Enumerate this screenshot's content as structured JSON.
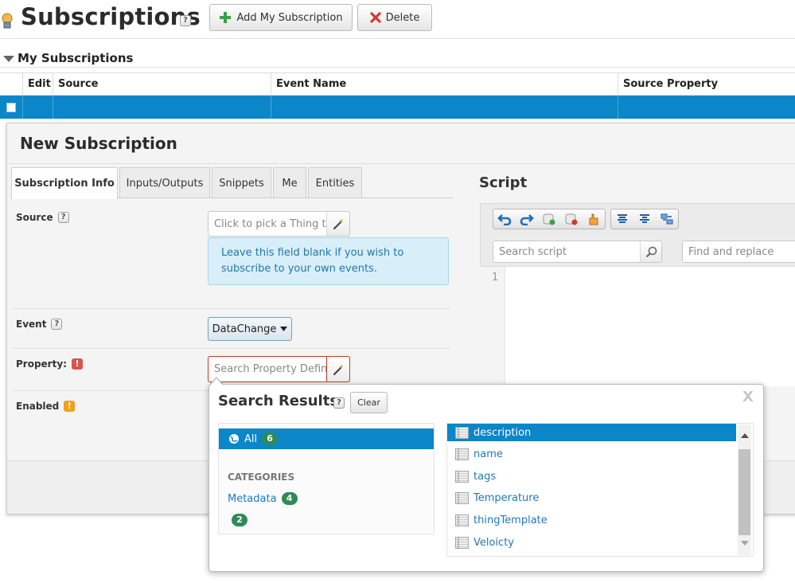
{
  "header": {
    "title": "Subscriptions",
    "help_glyph": "?",
    "add_button_label": "Add My Subscription",
    "delete_button_label": "Delete"
  },
  "my_subscriptions": {
    "section_title": "My Subscriptions",
    "columns": [
      "Edit",
      "Source",
      "Event Name",
      "Source Property"
    ],
    "rows": [
      {
        "selected": true,
        "edit": "",
        "source": "",
        "event_name": "",
        "source_property": ""
      }
    ]
  },
  "new_subscription": {
    "title": "New Subscription",
    "tabs": [
      {
        "label": "Subscription Info",
        "active": true
      },
      {
        "label": "Inputs/Outputs",
        "active": false
      },
      {
        "label": "Snippets",
        "active": false
      },
      {
        "label": "Me",
        "active": false
      },
      {
        "label": "Entities",
        "active": false
      }
    ],
    "form": {
      "source_label": "Source",
      "source_placeholder": "Click to pick a Thing to",
      "source_info": "Leave this field blank if you wish to subscribe to your own events.",
      "event_label": "Event",
      "event_value": "DataChange",
      "property_label": "Property:",
      "property_placeholder": "Search Property Defini",
      "property_status": "!",
      "enabled_label": "Enabled",
      "enabled_status": "!"
    }
  },
  "script": {
    "title": "Script",
    "toolbar_icons": [
      "undo-icon",
      "redo-icon",
      "add-snippet-icon",
      "remove-snippet-icon",
      "hand-icon",
      "align-left-icon",
      "align-center-icon",
      "format-icon"
    ],
    "search_placeholder": "Search script",
    "find_replace_placeholder": "Find and replace",
    "line_numbers": [
      "1"
    ]
  },
  "search_results": {
    "title": "Search Results",
    "clear_label": "Clear",
    "close_label": "X",
    "all_label": "All",
    "all_count": "6",
    "categories_heading": "CATEGORIES",
    "categories": [
      {
        "label": "Metadata",
        "count": "4"
      },
      {
        "label": "",
        "count": "2"
      }
    ],
    "results": [
      {
        "label": "description",
        "selected": true
      },
      {
        "label": "name",
        "selected": false
      },
      {
        "label": "tags",
        "selected": false
      },
      {
        "label": "Temperature",
        "selected": false
      },
      {
        "label": "thingTemplate",
        "selected": false
      },
      {
        "label": "Veloicty",
        "selected": false
      }
    ]
  },
  "colors": {
    "selection_blue": "#0a86c9",
    "badge_green": "#2e8b57",
    "info_bg": "#d8eef8",
    "error_red": "#d9534f"
  }
}
